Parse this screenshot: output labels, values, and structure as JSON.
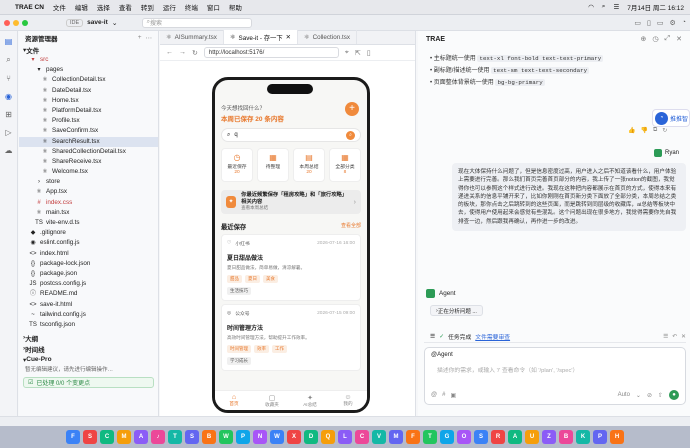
{
  "menubar": {
    "app": "TRAE CN",
    "items": [
      "文件",
      "编辑",
      "选择",
      "查看",
      "转到",
      "运行",
      "终端",
      "窗口",
      "帮助"
    ],
    "clock": "7月14日 周二 16:12"
  },
  "titlebar": {
    "ide": "IDE",
    "project": "save-it",
    "search": "搜索"
  },
  "explorer": {
    "title": "资源管理器",
    "section": "文件",
    "tree": [
      {
        "name": "src",
        "depth": 1,
        "icon": "▾",
        "color": "#c23c3c"
      },
      {
        "name": "pages",
        "depth": 2,
        "icon": "▾",
        "color": ""
      },
      {
        "name": "CollectionDetail.tsx",
        "depth": 3,
        "icon": "⚛",
        "color": ""
      },
      {
        "name": "DateDetail.tsx",
        "depth": 3,
        "icon": "⚛",
        "color": ""
      },
      {
        "name": "Home.tsx",
        "depth": 3,
        "icon": "⚛",
        "color": ""
      },
      {
        "name": "PlatformDetail.tsx",
        "depth": 3,
        "icon": "⚛",
        "color": ""
      },
      {
        "name": "Profile.tsx",
        "depth": 3,
        "icon": "⚛",
        "color": ""
      },
      {
        "name": "SaveConfirm.tsx",
        "depth": 3,
        "icon": "⚛",
        "color": ""
      },
      {
        "name": "SearchResult.tsx",
        "depth": 3,
        "icon": "⚛",
        "color": "",
        "sel": true
      },
      {
        "name": "SharedCollectionDetail.tsx",
        "depth": 3,
        "icon": "⚛",
        "color": ""
      },
      {
        "name": "ShareReceive.tsx",
        "depth": 3,
        "icon": "⚛",
        "color": ""
      },
      {
        "name": "Welcome.tsx",
        "depth": 3,
        "icon": "⚛",
        "color": ""
      },
      {
        "name": "store",
        "depth": 2,
        "icon": "›",
        "color": ""
      },
      {
        "name": "App.tsx",
        "depth": 2,
        "icon": "⚛",
        "color": ""
      },
      {
        "name": "index.css",
        "depth": 2,
        "icon": "#",
        "color": "#c23c3c"
      },
      {
        "name": "main.tsx",
        "depth": 2,
        "icon": "⚛",
        "color": ""
      },
      {
        "name": "vite-env.d.ts",
        "depth": 2,
        "icon": "TS",
        "color": ""
      },
      {
        "name": ".gitignore",
        "depth": 1,
        "icon": "◆",
        "color": ""
      },
      {
        "name": "eslint.config.js",
        "depth": 1,
        "icon": "◉",
        "color": ""
      },
      {
        "name": "index.html",
        "depth": 1,
        "icon": "<>",
        "color": ""
      },
      {
        "name": "package-lock.json",
        "depth": 1,
        "icon": "{}",
        "color": ""
      },
      {
        "name": "package.json",
        "depth": 1,
        "icon": "{}",
        "color": ""
      },
      {
        "name": "postcss.config.js",
        "depth": 1,
        "icon": "JS",
        "color": ""
      },
      {
        "name": "README.md",
        "depth": 1,
        "icon": "ⓘ",
        "color": ""
      },
      {
        "name": "save-it.html",
        "depth": 1,
        "icon": "<>",
        "color": ""
      },
      {
        "name": "tailwind.config.js",
        "depth": 1,
        "icon": "~",
        "color": ""
      },
      {
        "name": "tsconfig.json",
        "depth": 1,
        "icon": "TS",
        "color": ""
      }
    ],
    "outline": "大纲",
    "timeline": "时间线",
    "cue_title": "Cue-Pro",
    "cue_hint": "暂无编辑建议，请先进行编辑操作…",
    "cue_status": "已处理 0/0 个变更点"
  },
  "editor": {
    "tabs": [
      "AISummary.tsx",
      "Save-it - 存一下",
      "Collection.tsx"
    ],
    "url": "http://localhost:5176/"
  },
  "phone": {
    "greet": "今天想找回什么？",
    "saved": "本周已保存 20 条内容",
    "query": "q",
    "grid": [
      {
        "icon": "◷",
        "label": "最近保存",
        "num": "20"
      },
      {
        "icon": "▦",
        "label": "待整理",
        "num": ""
      },
      {
        "icon": "▤",
        "label": "本周总结",
        "num": "20"
      },
      {
        "icon": "▦",
        "label": "全部分类",
        "num": "8"
      }
    ],
    "promo_title": "你最近频繁保存「租房攻略」和「旅行攻略」相关内容",
    "promo_sub": "查看本周总结",
    "recent": "最近保存",
    "more": "查看全部",
    "cards": [
      {
        "src": "小红书",
        "date": "2026-07-16 16:00",
        "title": "夏日甜品做法",
        "desc": "夏日甜品做法，简单易做，清凉解暑。",
        "tags": [
          "甜品",
          "夏日",
          "美食"
        ],
        "tag2": "生活技巧"
      },
      {
        "src": "公众号",
        "date": "2026-07-15 09:00",
        "title": "时间管理方法",
        "desc": "高效时间管理方法，帮助提升工作效率。",
        "tags": [
          "时间管理",
          "效率",
          "工作"
        ],
        "tag2": "学习成长"
      }
    ],
    "nav": [
      {
        "icon": "⌂",
        "label": "首页"
      },
      {
        "icon": "▢",
        "label": "收藏夹"
      },
      {
        "icon": "✦",
        "label": "AI总结"
      },
      {
        "icon": "☺",
        "label": "我的"
      }
    ]
  },
  "panel": {
    "title": "TRAE",
    "bullets": [
      {
        "text": "主标题统一使用",
        "code": "text-xl font-bold text-text-primary"
      },
      {
        "text": "副标题/描述统一使用",
        "code": "text-sm text-text-secondary"
      },
      {
        "text": "页面整体背景统一使用",
        "code": "bg-bg-primary"
      }
    ],
    "float": "推推智",
    "user": "Ryan",
    "message": "现在大体保持什么问题了，但是信息密度过高，用户进入之后不知道该看什么，用户体验上需要进行完善。那么我们首页完善首页部分的内容，我上传了一张notion的截图，我觉得你也可以参照这个样式进行改进。我现在这种把内容都展示在首页的方式，使得本来有递进关系的信息平铺开来了，比如你刚刚在首页新分类下面放了全部分类，本周总结之类的板块，那你点击之后跳转到的这些页面，而是跳转到同层级的收藏库，ai总结等板块中去，使得用户使用起来会感觉有些混乱。这个问题出现在很多地方，我觉得需要你先自我排查一边，然后跟我再确认，再作进一步的改进。",
    "agent": "Agent",
    "analyzing": "正在分析问题 ...",
    "task": "任务完成",
    "review": "文件需要审查",
    "at": "@Agent",
    "placeholder": "描述你的需求，或输入 '/' 查看命令（如 '/plan', '/spec'）",
    "auto": "Auto"
  },
  "dock": [
    "F",
    "S",
    "C",
    "M",
    "A",
    "♪",
    "T",
    "S",
    "B",
    "W",
    "P",
    "N",
    "W",
    "X",
    "D",
    "Q",
    "L",
    "C",
    "V",
    "M",
    "F",
    "T",
    "G",
    "O",
    "S",
    "R",
    "A",
    "U",
    "Z",
    "B",
    "K",
    "P",
    "H"
  ]
}
